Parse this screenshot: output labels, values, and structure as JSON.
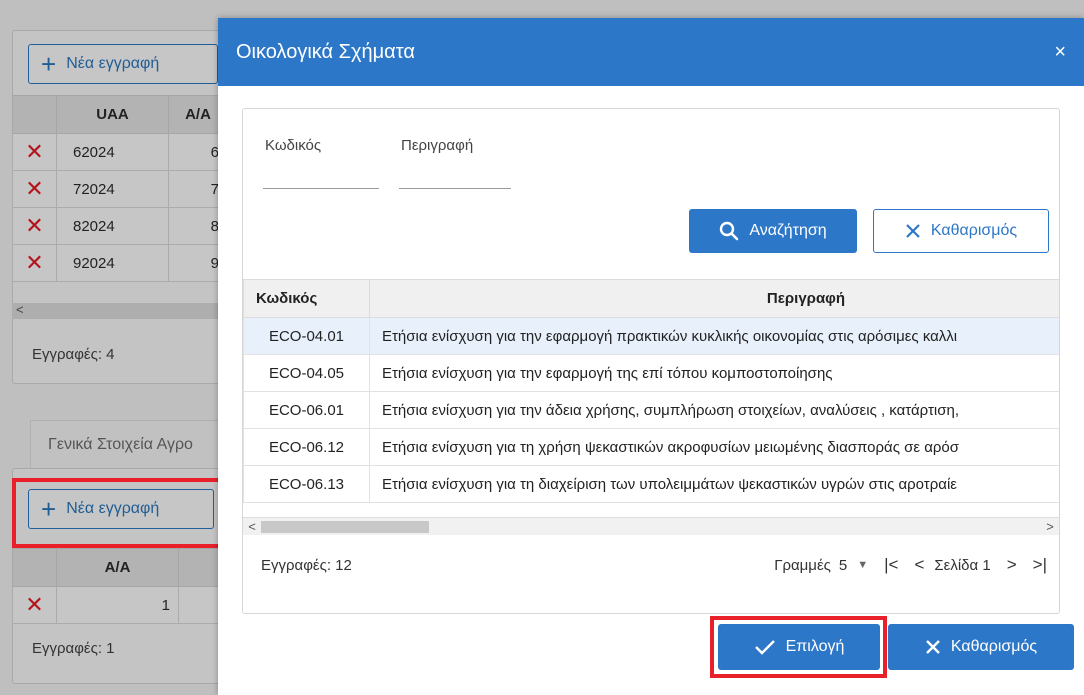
{
  "background": {
    "top_panel": {
      "new_record_label": "Νέα εγγραφή",
      "columns": [
        "UAA",
        "A/A"
      ],
      "rows": [
        {
          "code": "62024",
          "num": "6"
        },
        {
          "code": "72024",
          "num": "7"
        },
        {
          "code": "82024",
          "num": "8"
        },
        {
          "code": "92024",
          "num": "9"
        }
      ],
      "records_label": "Εγγραφές: 4"
    },
    "tab_label": "Γενικά Στοιχεία Αγρο",
    "bottom_panel": {
      "new_record_label": "Νέα εγγραφή",
      "columns": [
        "A/A"
      ],
      "rows": [
        {
          "num": "1"
        }
      ],
      "records_label": "Εγγραφές: 1"
    }
  },
  "modal": {
    "title": "Οικολογικά Σχήματα",
    "close_glyph": "×",
    "filters": {
      "code_label": "Κωδικός",
      "description_label": "Περιγραφή",
      "code_value": "",
      "description_value": ""
    },
    "search_label": "Αναζήτηση",
    "clear_label": "Καθαρισμός",
    "grid": {
      "columns": [
        "Κωδικός",
        "Περιγραφή"
      ],
      "rows": [
        {
          "code": "ECO-04.01",
          "description": "Ετήσια ενίσχυση για την εφαρμογή πρακτικών κυκλικής οικονομίας στις αρόσιμες καλλι"
        },
        {
          "code": "ECO-04.05",
          "description": "Ετήσια ενίσχυση για την εφαρμογή της επί τόπου κομποστοποίησης"
        },
        {
          "code": "ECO-06.01",
          "description": "Ετήσια ενίσχυση για την άδεια χρήσης, συμπλήρωση στοιχείων, αναλύσεις , κατάρτιση,"
        },
        {
          "code": "ECO-06.12",
          "description": "Ετήσια ενίσχυση για τη χρήση ψεκαστικών ακροφυσίων μειωμένης διασποράς σε αρόσ"
        },
        {
          "code": "ECO-06.13",
          "description": "Ετήσια ενίσχυση για τη διαχείριση των υπολειμμάτων ψεκαστικών υγρών στις αροτραίε"
        }
      ]
    },
    "records_label": "Εγγραφές: 12",
    "pager": {
      "rows_label": "Γραμμές",
      "rows_value": "5",
      "page_label": "Σελίδα 1"
    },
    "select_label": "Επιλογή",
    "footer_clear_label": "Καθαρισμός"
  },
  "colors": {
    "primary": "#2c77c8",
    "highlight": "#e8202a",
    "delete": "#b3141b"
  }
}
